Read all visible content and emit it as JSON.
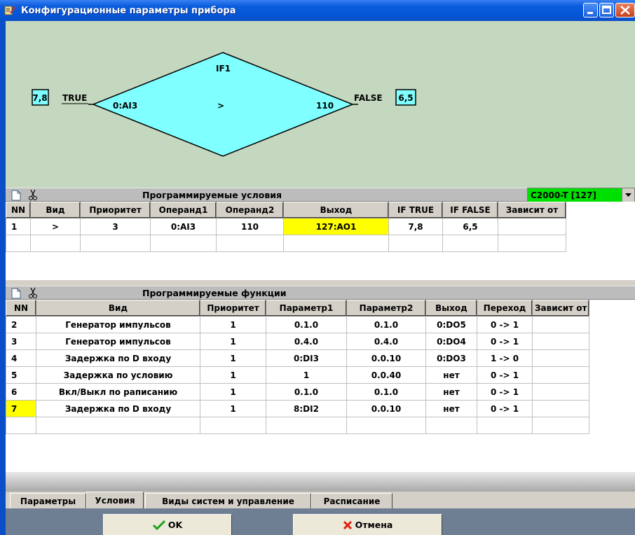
{
  "window": {
    "title": "Конфигурационные параметры прибора"
  },
  "diagram": {
    "node_label": "IF1",
    "operand1": "0:AI3",
    "operator": ">",
    "operand2": "110",
    "true_label": "TRUE",
    "true_target": "7,8",
    "false_label": "FALSE",
    "false_target": "6,5"
  },
  "conditions": {
    "title": "Программируемые условия",
    "device": "C2000-T [127]",
    "columns": [
      "NN",
      "Вид",
      "Приоритет",
      "Операнд1",
      "Операнд2",
      "Выход",
      "IF TRUE",
      "IF FALSE",
      "Зависит от"
    ],
    "rows": [
      [
        "1",
        ">",
        "3",
        "0:AI3",
        "110",
        "127:AO1",
        "7,8",
        "6,5",
        ""
      ]
    ]
  },
  "functions": {
    "title": "Программируемые функции",
    "columns": [
      "NN",
      "Вид",
      "Приоритет",
      "Параметр1",
      "Параметр2",
      "Выход",
      "Переход",
      "Зависит от"
    ],
    "rows": [
      [
        "2",
        "Генератор импульсов",
        "1",
        "0.1.0",
        "0.1.0",
        "0:DO5",
        "0 -> 1",
        ""
      ],
      [
        "3",
        "Генератор импульсов",
        "1",
        "0.4.0",
        "0.4.0",
        "0:DO4",
        "0 -> 1",
        ""
      ],
      [
        "4",
        "Задержка по D входу",
        "1",
        "0:DI3",
        "0.0.10",
        "0:DO3",
        "1 -> 0",
        ""
      ],
      [
        "5",
        "Задержка по условию",
        "1",
        "1",
        "0.0.40",
        "нет",
        "0 -> 1",
        ""
      ],
      [
        "6",
        "Вкл/Выкл по раписанию",
        "1",
        "0.1.0",
        "0.1.0",
        "нет",
        "0 -> 1",
        ""
      ],
      [
        "7",
        "Задержка по D входу",
        "1",
        "8:DI2",
        "0.0.10",
        "нет",
        "0 -> 1",
        ""
      ]
    ]
  },
  "tabs": [
    "Параметры",
    "Условия",
    "Виды систем и управление",
    "Расписание"
  ],
  "buttons": {
    "ok": "OK",
    "cancel": "Отмена"
  },
  "colors": {
    "diamond": "#7fffff",
    "diagram_bg": "#c4d7bf",
    "highlight": "#ffff00",
    "device_bg": "#00e000"
  }
}
